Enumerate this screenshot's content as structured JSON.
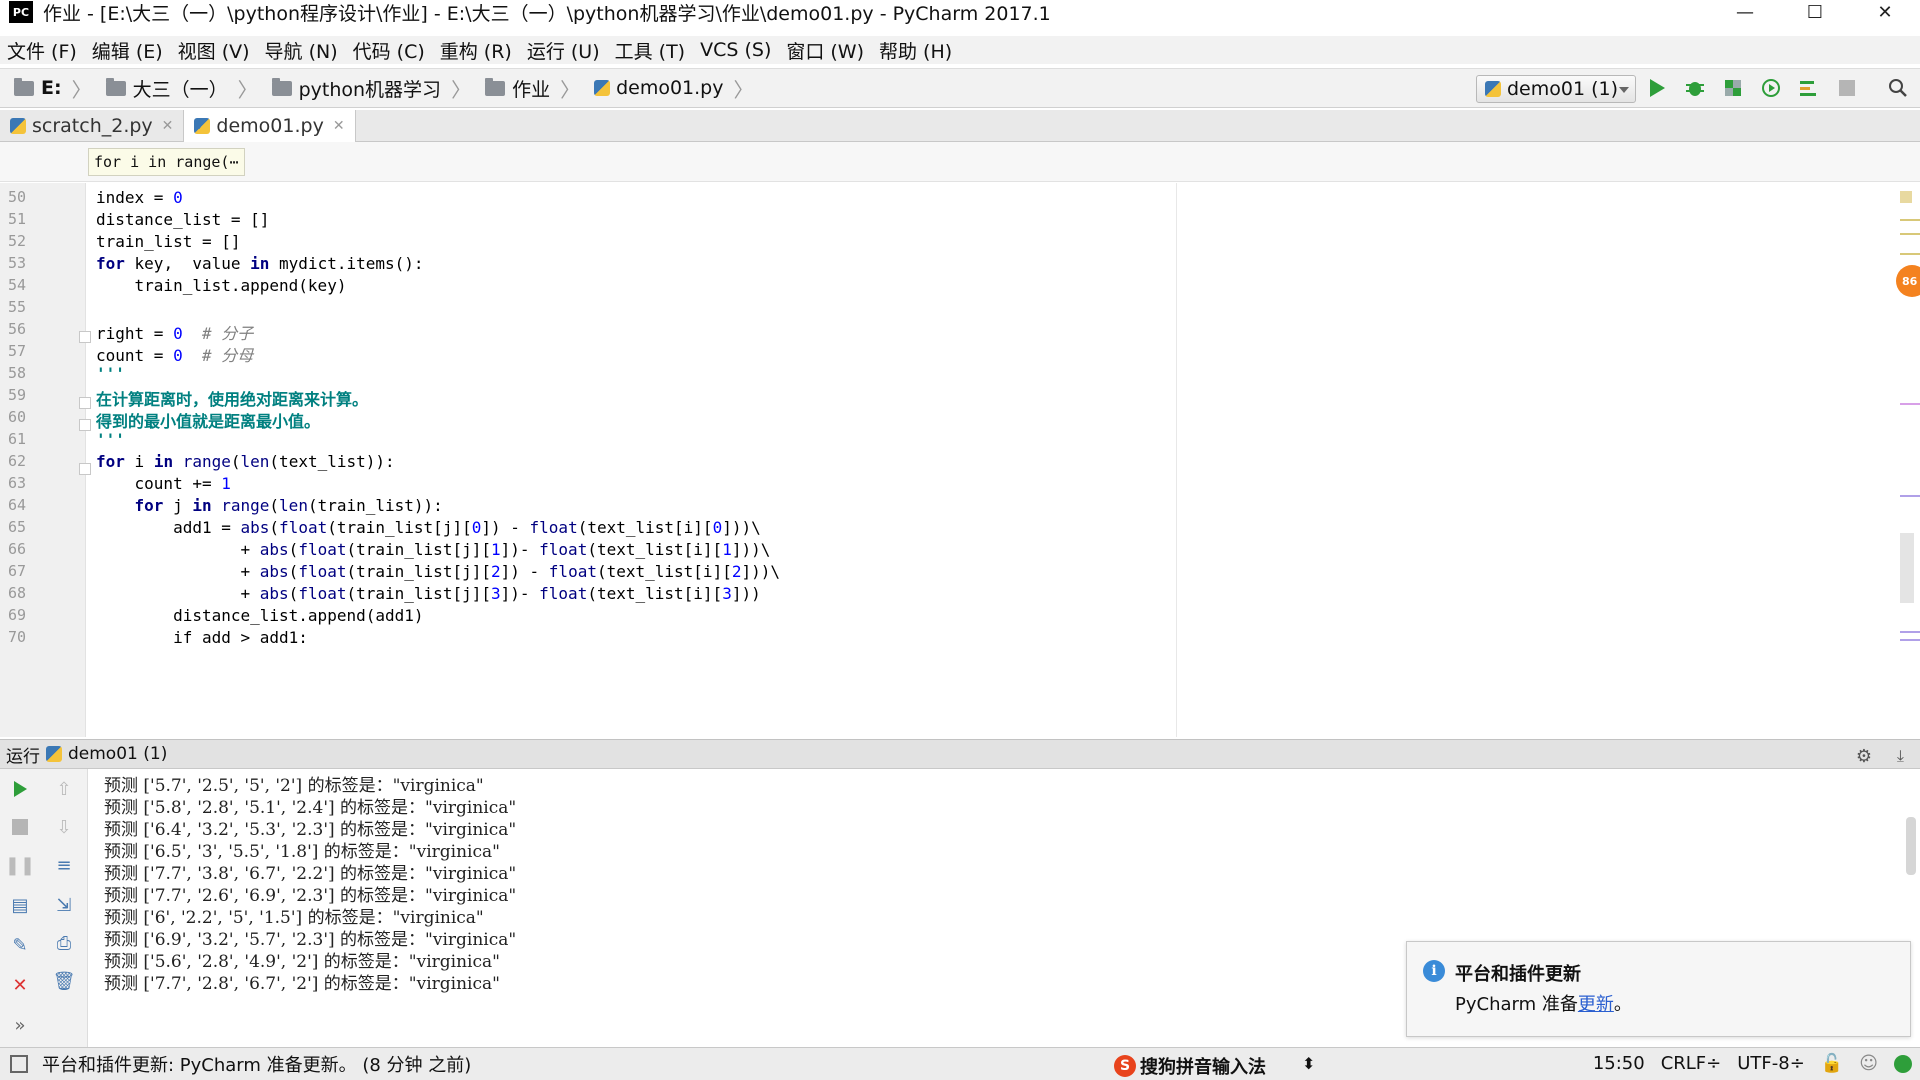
{
  "window": {
    "app_logo": "PC",
    "title": "作业 - [E:\\大三（一）\\python程序设计\\作业] - E:\\大三（一）\\python机器学习\\作业\\demo01.py - PyCharm 2017.1",
    "minimize": "—",
    "maximize": "☐",
    "close": "✕"
  },
  "menu": [
    "文件 (F)",
    "编辑 (E)",
    "视图 (V)",
    "导航 (N)",
    "代码 (C)",
    "重构 (R)",
    "运行 (U)",
    "工具 (T)",
    "VCS (S)",
    "窗口 (W)",
    "帮助 (H)"
  ],
  "breadcrumb": [
    "E:",
    "大三（一）",
    "python机器学习",
    "作业",
    "demo01.py"
  ],
  "run_config": "demo01 (1)",
  "tabs": [
    {
      "label": "scratch_2.py",
      "close": "✕"
    },
    {
      "label": "demo01.py",
      "close": "✕"
    }
  ],
  "hint": "for i in range(⋯",
  "inspection_badge": "86",
  "line_numbers": [
    "50",
    "51",
    "52",
    "53",
    "54",
    "55",
    "56",
    "57",
    "58",
    "59",
    "60",
    "61",
    "62",
    "63",
    "64",
    "65",
    "66",
    "67",
    "68",
    "69",
    "70"
  ],
  "code": {
    "l50_a": "index = ",
    "l50_b": "0",
    "l51": "distance_list = []",
    "l52": "train_list = []",
    "l53_kw1": "for",
    "l53_a": " key,  value ",
    "l53_kw2": "in",
    "l53_b": " mydict.items():",
    "l54": "    train_list.append(key)",
    "l56_a": "right = ",
    "l56_b": "0",
    "l56_c": "  # 分子",
    "l57_a": "count = ",
    "l57_b": "0",
    "l57_c": "  # 分母",
    "l58": "'''",
    "l59": "在计算距离时，使用绝对距离来计算。",
    "l60": "得到的最小值就是距离最小值。",
    "l61": "'''",
    "l62_kw1": "for",
    "l62_a": " i ",
    "l62_kw2": "in",
    "l62_b": " range",
    "l62_c": "(",
    "l62_d": "len",
    "l62_e": "(text_list)):",
    "l63_a": "    count += ",
    "l63_b": "1",
    "l64_sp": "    ",
    "l64_kw1": "for",
    "l64_a": " j ",
    "l64_kw2": "in",
    "l64_b": " range",
    "l64_c": "(",
    "l64_d": "len",
    "l64_e": "(train_list)):",
    "l65_a": "        add1 = ",
    "l65_b": "abs",
    "l65_c": "(",
    "l65_d": "float",
    "l65_e": "(train_list[j][",
    "l65_f": "0",
    "l65_g": "]) - ",
    "l65_h": "float",
    "l65_i": "(text_list[i][",
    "l65_j": "0",
    "l65_k": "]))\\",
    "l66_a": "               + ",
    "l66_b": "abs",
    "l66_c": "(",
    "l66_d": "float",
    "l66_e": "(train_list[j][",
    "l66_f": "1",
    "l66_g": "])- ",
    "l66_h": "float",
    "l66_i": "(text_list[i][",
    "l66_j": "1",
    "l66_k": "]))\\",
    "l67_a": "               + ",
    "l67_b": "abs",
    "l67_c": "(",
    "l67_d": "float",
    "l67_e": "(train_list[j][",
    "l67_f": "2",
    "l67_g": "]) - ",
    "l67_h": "float",
    "l67_i": "(text_list[i][",
    "l67_j": "2",
    "l67_k": "]))\\",
    "l68_a": "               + ",
    "l68_b": "abs",
    "l68_c": "(",
    "l68_d": "float",
    "l68_e": "(train_list[j][",
    "l68_f": "3",
    "l68_g": "])- ",
    "l68_h": "float",
    "l68_i": "(text_list[i][",
    "l68_j": "3",
    "l68_k": "]))",
    "l69": "        distance_list.append(add1)",
    "l70": "        if add > add1:"
  },
  "run_panel": {
    "label": "运行",
    "config": "demo01 (1)",
    "output": [
      "预测 ['5.7', '2.5', '5', '2'] 的标签是：\"virginica\"",
      "预测 ['5.8', '2.8', '5.1', '2.4'] 的标签是：\"virginica\"",
      "预测 ['6.4', '3.2', '5.3', '2.3'] 的标签是：\"virginica\"",
      "预测 ['6.5', '3', '5.5', '1.8'] 的标签是：\"virginica\"",
      "预测 ['7.7', '3.8', '6.7', '2.2'] 的标签是：\"virginica\"",
      "预测 ['7.7', '2.6', '6.9', '2.3'] 的标签是：\"virginica\"",
      "预测 ['6', '2.2', '5', '1.5'] 的标签是：\"virginica\"",
      "预测 ['6.9', '3.2', '5.7', '2.3'] 的标签是：\"virginica\"",
      "预测 ['5.6', '2.8', '4.9', '2'] 的标签是：\"virginica\"",
      "预测 ['7.7', '2.8', '6.7', '2'] 的标签是：\"virginica\""
    ]
  },
  "notification": {
    "title": "平台和插件更新",
    "body_prefix": "PyCharm 准备",
    "link": "更新",
    "body_suffix": "。"
  },
  "status": {
    "message": "平台和插件更新: PyCharm 准备更新。 (8 分钟 之前)",
    "ime_logo": "S",
    "ime": "搜狗拼音输入法",
    "ime_arrows": "⬍",
    "position": "15:50",
    "line_sep": "CRLF÷",
    "encoding": "UTF-8÷"
  },
  "colors": {
    "keyword": "#000080",
    "number": "#0000ff",
    "comment": "#808080",
    "docstring": "#008080",
    "run_green": "#2e9e3a"
  }
}
